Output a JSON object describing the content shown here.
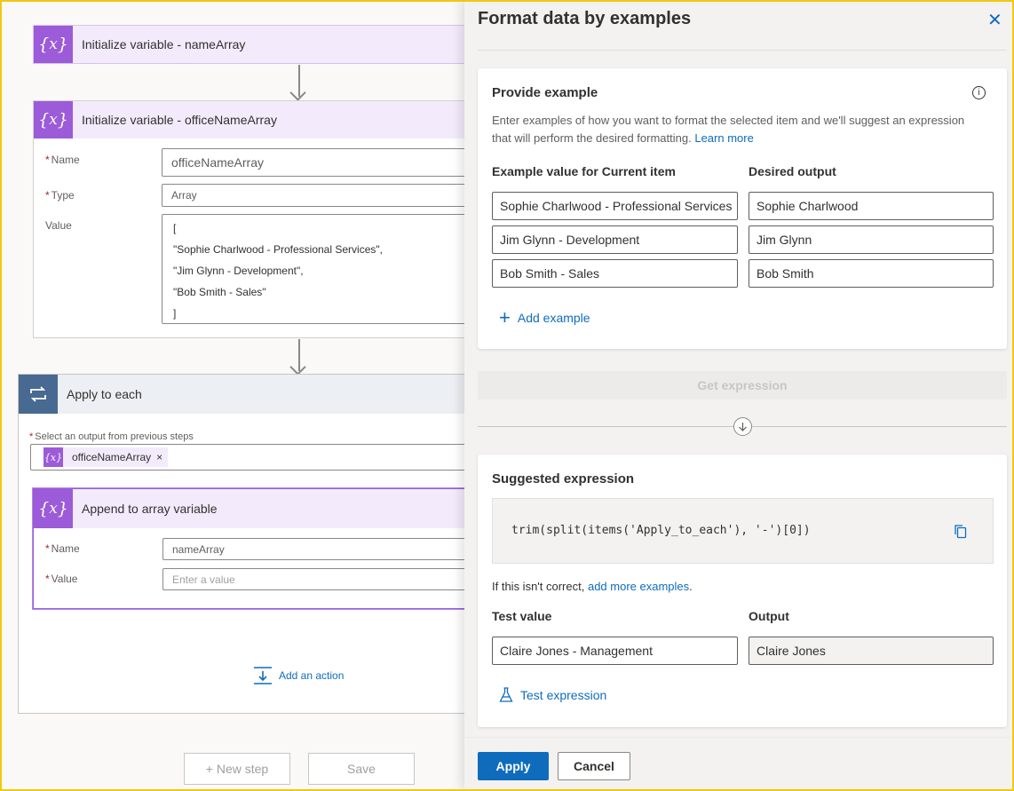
{
  "canvas": {
    "card_name_array": {
      "title": "Initialize variable - nameArray",
      "icon": "variable-icon"
    },
    "card_office": {
      "title": "Initialize variable - officeNameArray",
      "name_label": "Name",
      "name_value": "officeNameArray",
      "type_label": "Type",
      "type_value": "Array",
      "value_label": "Value",
      "value_lines": [
        "[",
        "\"Sophie Charlwood - Professional Services\",",
        "\"Jim Glynn - Development\",",
        "\"Bob Smith - Sales\"",
        "]"
      ]
    },
    "apply_to_each": {
      "title": "Apply to each",
      "select_label": "Select an output from previous steps",
      "token": "officeNameArray",
      "token_remove": "×"
    },
    "append": {
      "title": "Append to array variable",
      "name_label": "Name",
      "name_value": "nameArray",
      "value_label": "Value",
      "value_placeholder": "Enter a value"
    },
    "add_action": "Add an action",
    "new_step": "+ New step",
    "save": "Save",
    "required_marker": "*"
  },
  "panel": {
    "title": "Format data by examples",
    "close": "✕",
    "provide": {
      "title": "Provide example",
      "desc": "Enter examples of how you want to format the selected item and we'll suggest an expression that will perform the desired formatting.",
      "learn_more": "Learn more",
      "col_example": "Example value for Current item",
      "col_output": "Desired output",
      "rows": [
        {
          "example": "Sophie Charlwood - Professional Services",
          "output": "Sophie Charlwood"
        },
        {
          "example": "Jim Glynn - Development",
          "output": "Jim Glynn"
        },
        {
          "example": "Bob Smith - Sales",
          "output": "Bob Smith"
        }
      ],
      "add_example": "Add example"
    },
    "get_expression": "Get expression",
    "suggested": {
      "title": "Suggested expression",
      "expression": "trim(split(items('Apply_to_each'), '-')[0])",
      "not_correct": "If this isn't correct,",
      "add_more": "add more examples",
      "period": ".",
      "test_label": "Test value",
      "output_label": "Output",
      "test_value": "Claire Jones - Management",
      "output_value": "Claire Jones",
      "test_button": "Test expression"
    },
    "apply": "Apply",
    "cancel": "Cancel"
  },
  "colors": {
    "accent": "#0f6cbd",
    "variable": "#9c5bd8",
    "loop": "#486991",
    "frame": "#f2c811"
  }
}
